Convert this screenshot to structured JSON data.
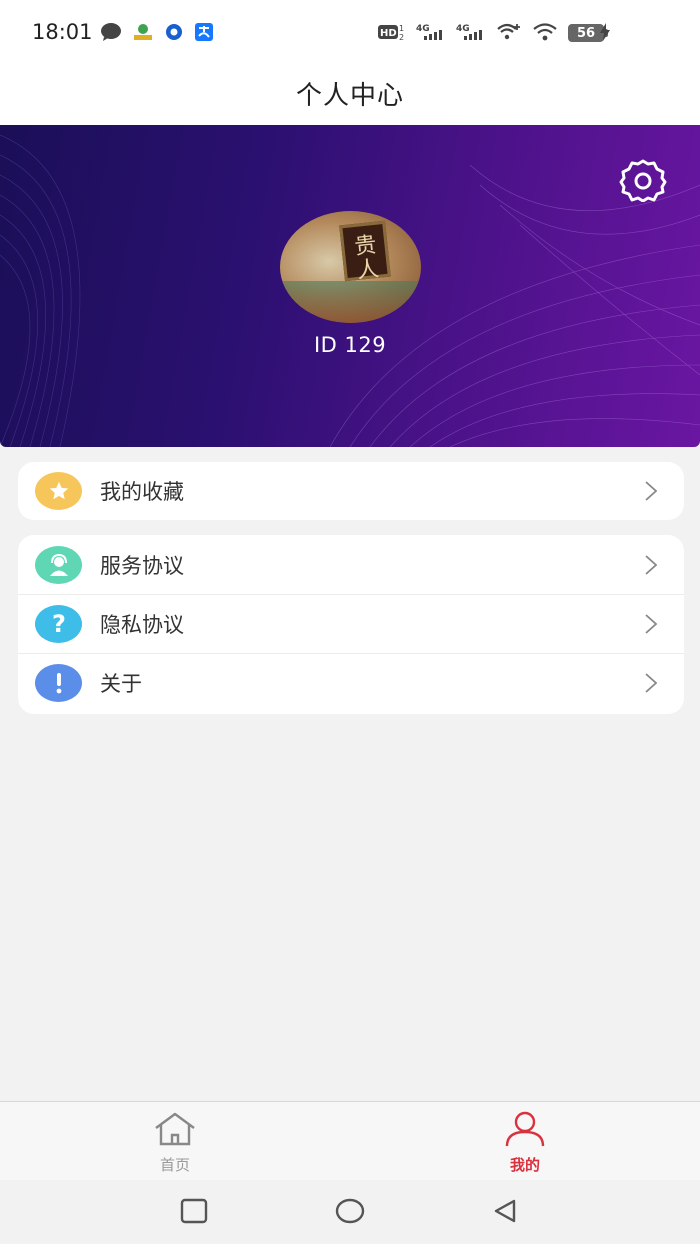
{
  "status_bar": {
    "time": "18:01",
    "left_icons": [
      "message-icon",
      "app-icon",
      "app-icon",
      "alipay-icon"
    ],
    "network_label_hd": "HD",
    "network_4g_1": "4G",
    "network_4g_2": "4G",
    "battery": "56"
  },
  "header": {
    "title": "个人中心"
  },
  "profile": {
    "user_id": "ID 129"
  },
  "menu_group_1": [
    {
      "label": "我的收藏",
      "icon": "star-icon",
      "color": "#f7c65b"
    }
  ],
  "menu_group_2": [
    {
      "label": "服务协议",
      "icon": "service-agent-icon",
      "color": "#5fd6b4"
    },
    {
      "label": "隐私协议",
      "icon": "question-icon",
      "color": "#3dbde7"
    },
    {
      "label": "关于",
      "icon": "exclamation-icon",
      "color": "#5b8ee8"
    }
  ],
  "tab_bar": {
    "tabs": [
      {
        "label": "首页",
        "icon": "home-icon",
        "active": false
      },
      {
        "label": "我的",
        "icon": "user-icon",
        "active": true
      }
    ],
    "active_color": "#d9323f"
  },
  "nav_bar": {
    "buttons": [
      "recent-apps-icon",
      "home-circle-icon",
      "back-triangle-icon"
    ]
  }
}
